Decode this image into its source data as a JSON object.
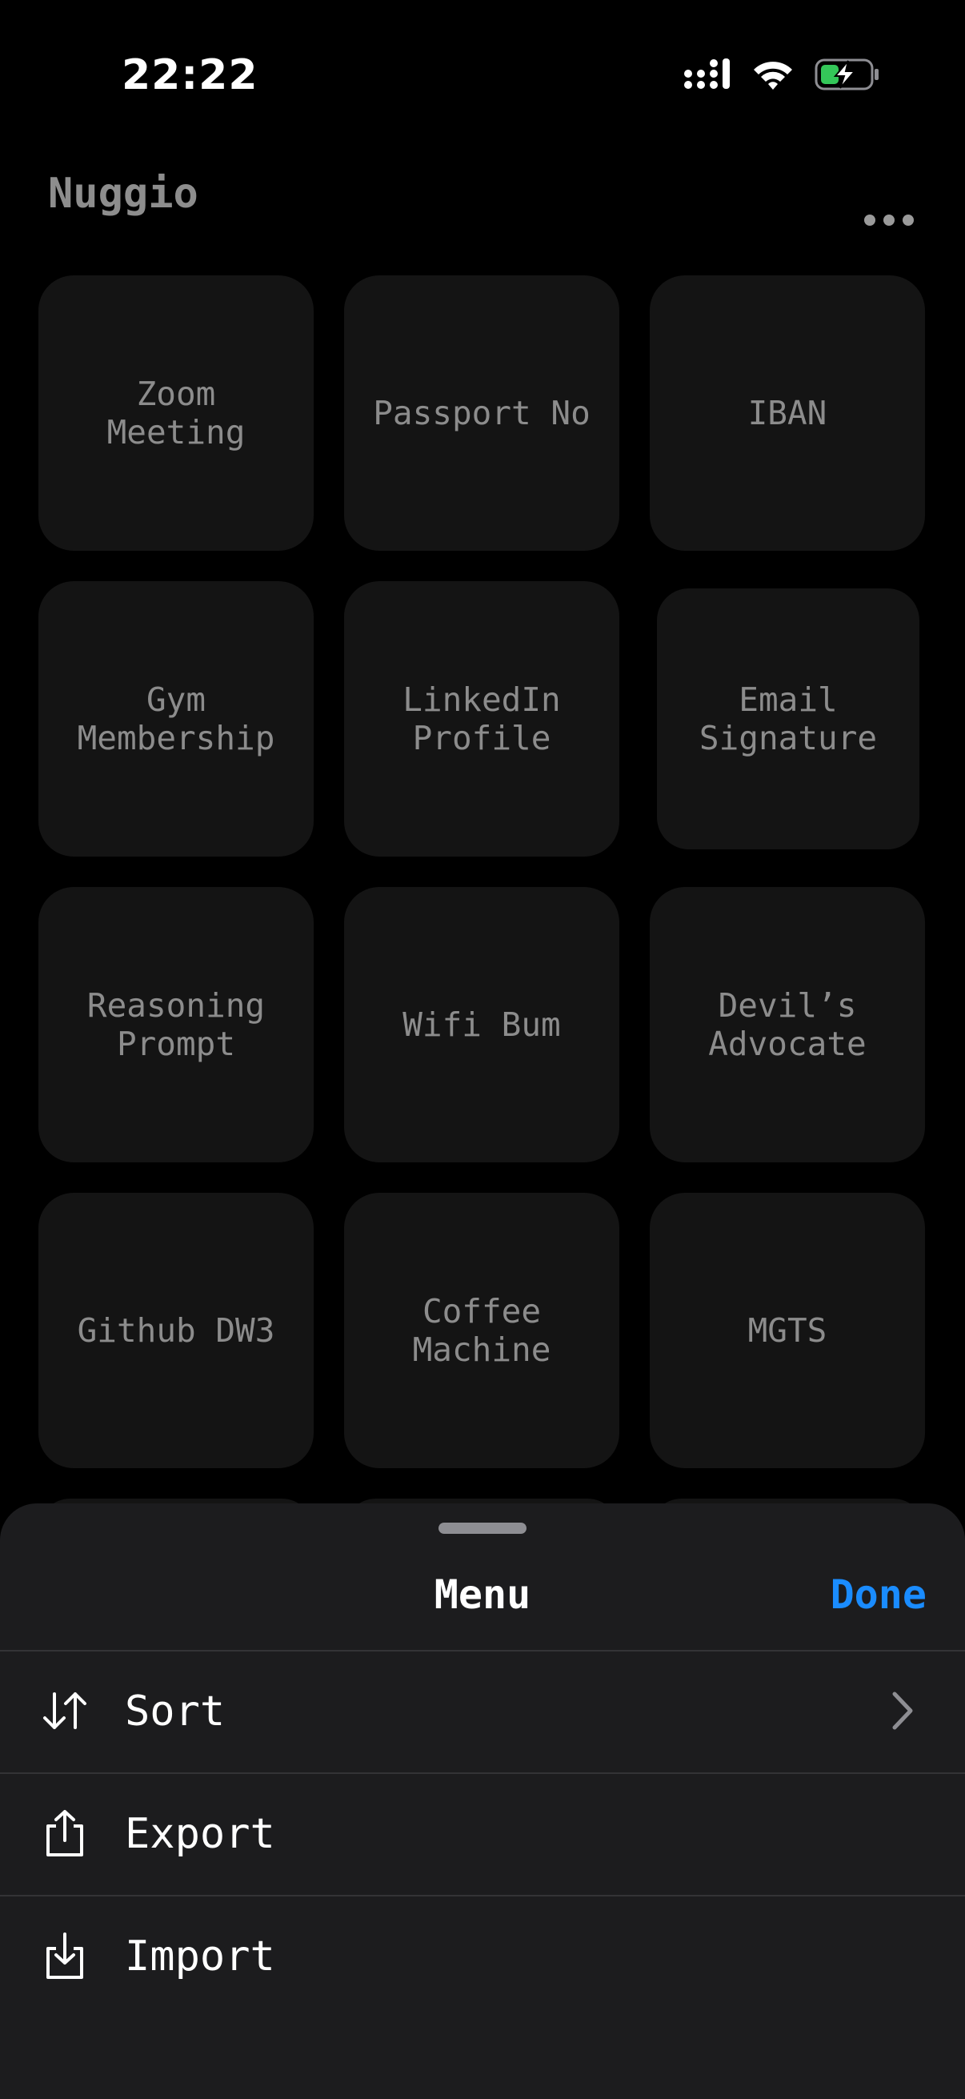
{
  "status_bar": {
    "time": "22:22"
  },
  "header": {
    "title": "Nuggio"
  },
  "tiles": [
    {
      "label": "Zoom\nMeeting"
    },
    {
      "label": "Passport No"
    },
    {
      "label": "IBAN"
    },
    {
      "label": "Gym\nMembership"
    },
    {
      "label": "LinkedIn\nProfile"
    },
    {
      "label": "Email\nSignature"
    },
    {
      "label": "Reasoning\nPrompt"
    },
    {
      "label": "Wifi Bum"
    },
    {
      "label": "Devil’s\nAdvocate"
    },
    {
      "label": "Github DW3"
    },
    {
      "label": "Coffee\nMachine"
    },
    {
      "label": "MGTS"
    }
  ],
  "sheet": {
    "title": "Menu",
    "done_label": "Done",
    "items": [
      {
        "label": "Sort",
        "icon": "sort-arrows-icon"
      },
      {
        "label": "Export",
        "icon": "share-up-icon"
      },
      {
        "label": "Import",
        "icon": "tray-down-icon"
      }
    ]
  },
  "colors": {
    "background": "#000000",
    "tile": "#141414",
    "sheet": "#1c1c1e",
    "accent": "#1a8cff",
    "battery_charge": "#34c759"
  }
}
